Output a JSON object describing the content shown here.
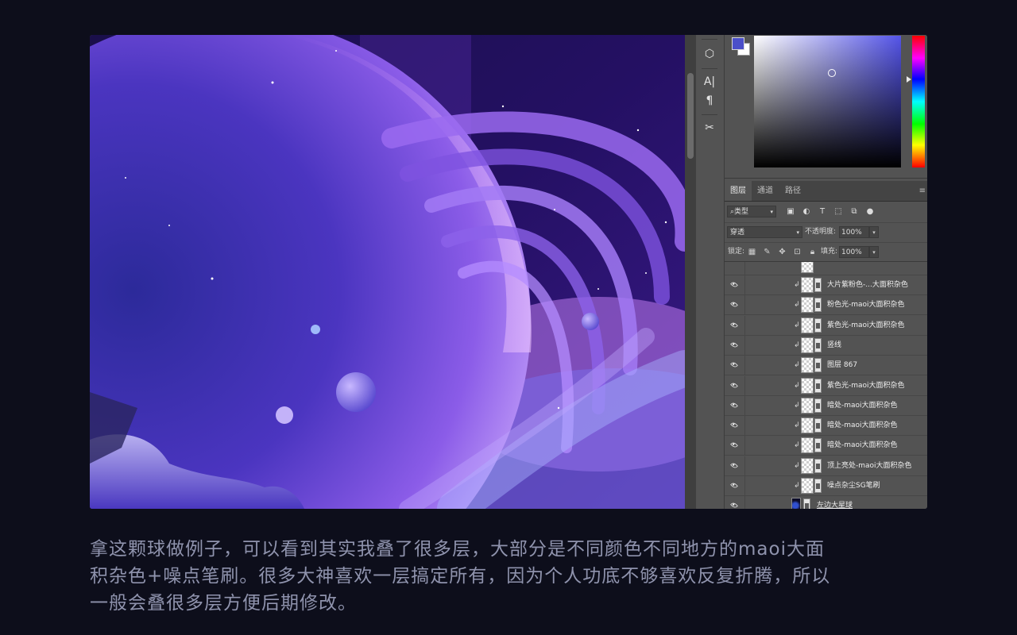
{
  "layers_panel": {
    "tabs": [
      "图层",
      "通道",
      "路径"
    ],
    "filter_kind": "类型",
    "blend_mode": "穿透",
    "opacity_label": "不透明度:",
    "opacity_value": "100%",
    "lock_label": "锁定:",
    "fill_label": "填充:",
    "fill_value": "100%",
    "layers": [
      {
        "name": "大片紫粉色-...大面积杂色",
        "visible": true,
        "clipped": true
      },
      {
        "name": "粉色光-maoi大面积杂色",
        "visible": true,
        "clipped": true
      },
      {
        "name": "紫色光-maoi大面积杂色",
        "visible": true,
        "clipped": true
      },
      {
        "name": "竖线",
        "visible": true,
        "clipped": true
      },
      {
        "name": "图层 867",
        "visible": true,
        "clipped": true
      },
      {
        "name": "紫色光-maoi大面积杂色",
        "visible": true,
        "clipped": true
      },
      {
        "name": "暗处-maoi大面积杂色",
        "visible": true,
        "clipped": true
      },
      {
        "name": "暗处-maoi大面积杂色",
        "visible": true,
        "clipped": true
      },
      {
        "name": "暗处-maoi大面积杂色",
        "visible": true,
        "clipped": true
      },
      {
        "name": "顶上亮处-maoi大面积杂色",
        "visible": true,
        "clipped": true
      },
      {
        "name": "噪点杂尘SG笔刷",
        "visible": true,
        "clipped": true
      },
      {
        "name": "左边大星球",
        "visible": true,
        "clipped": false
      }
    ]
  },
  "color_picker": {
    "foreground": "#4b4fc9",
    "background": "#ffffff",
    "hue_color": "#5454e8"
  },
  "toolbar_icons": [
    "3d-icon",
    "character-icon",
    "paragraph-icon",
    "tools-icon"
  ],
  "caption_lines": [
    "拿这颗球做例子，可以看到其实我叠了很多层，大部分是不同颜色不同地方的maoi大面",
    "积杂色+噪点笔刷。很多大神喜欢一层搞定所有，因为个人功底不够喜欢反复折腾，所以",
    "一般会叠很多层方便后期修改。"
  ]
}
